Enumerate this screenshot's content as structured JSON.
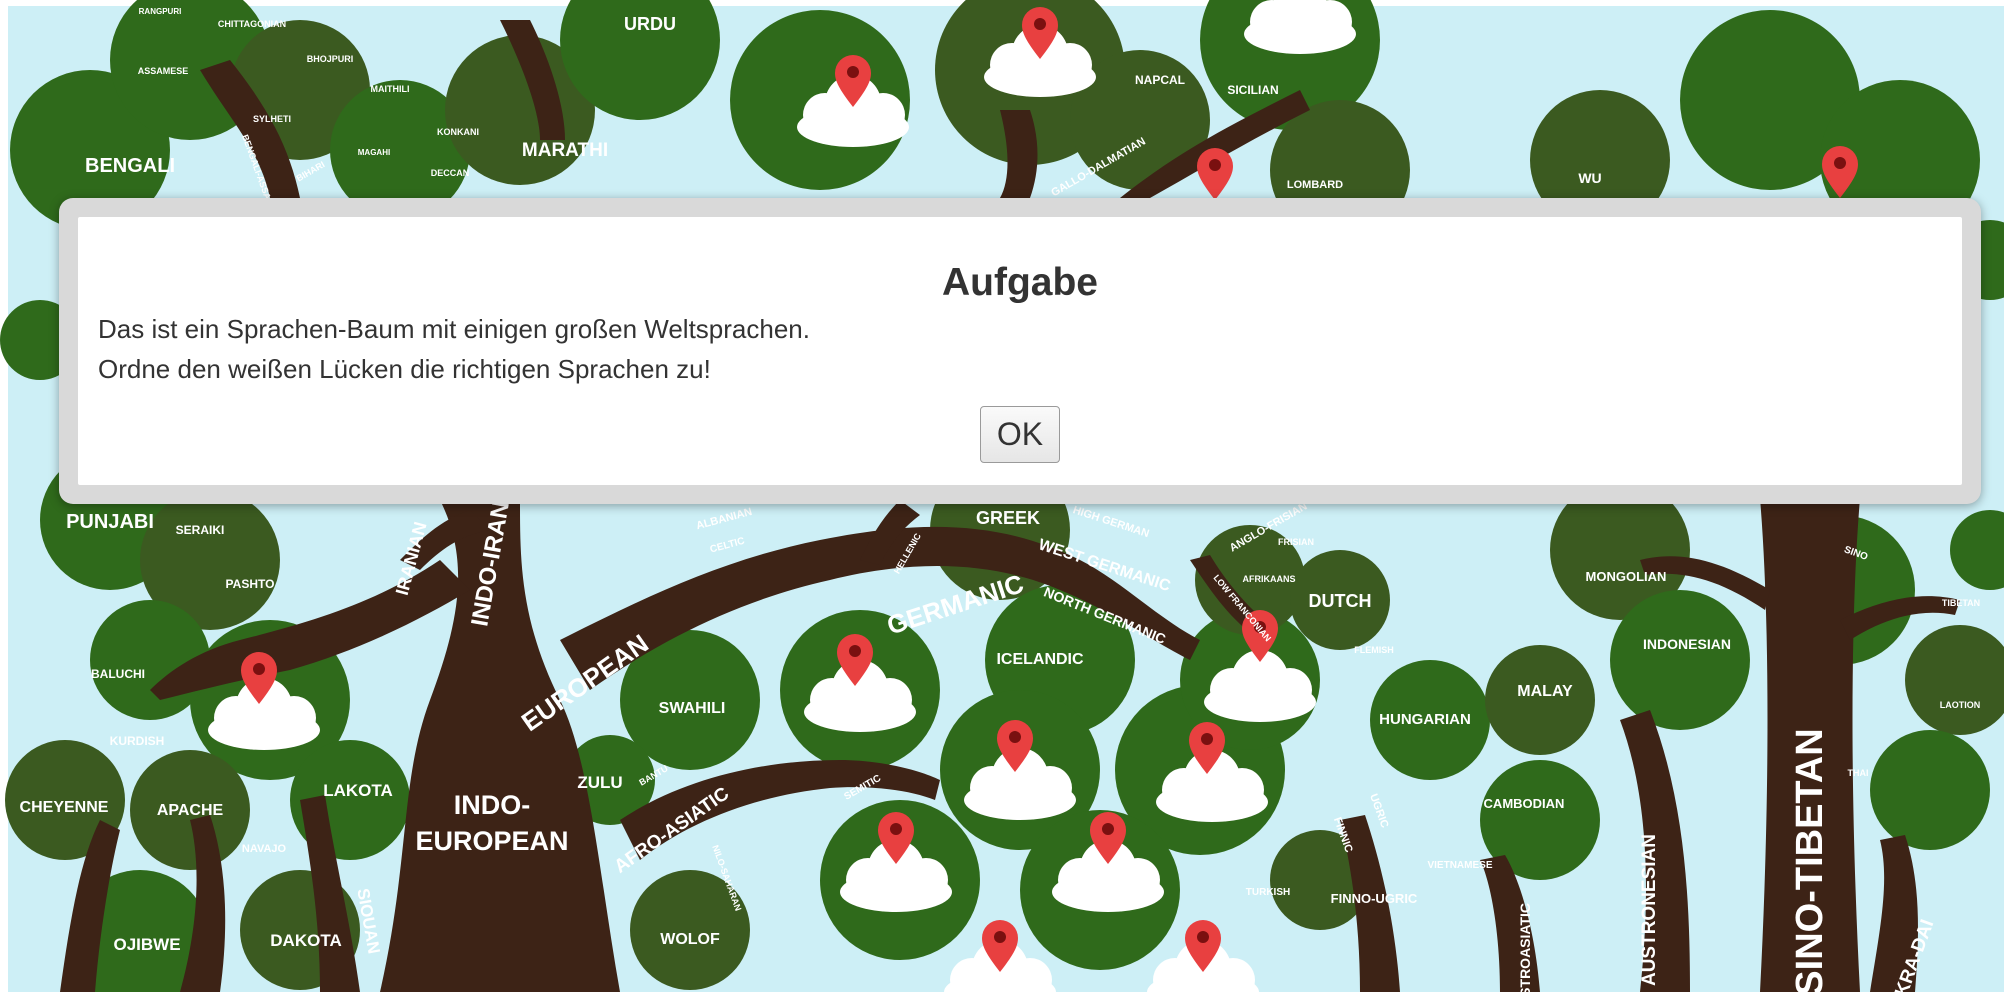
{
  "tree_labels": {
    "bengali": "BENGALI",
    "urdu": "URDU",
    "marathi": "MARATHI",
    "napcal": "NAPCAL",
    "sicilian": "SICILIAN",
    "lombard": "LOMBARD",
    "wu": "WU",
    "punjabi": "PUNJABI",
    "seraiki": "SERAIKI",
    "pashto": "PASHTO",
    "baluchi": "BALUCHI",
    "kurdish": "KURDISH",
    "iranian": "IRANIAN",
    "indo_iranian": "INDO-IRAN",
    "european": "EUROPEAN",
    "indo": "INDO-",
    "europeanb": "EUROPEAN",
    "germanic": "GERMANIC",
    "greek": "GREEK",
    "west_germanic": "WEST GERMANIC",
    "north_germanic": "NORTH GERMANIC",
    "icelandic": "ICELANDIC",
    "dutch": "DUTCH",
    "afrikaans": "AFRIKAANS",
    "flemish": "FLEMISH",
    "swahili": "SWAHILI",
    "zulu": "ZULU",
    "bantu": "BANTU",
    "afro_asiatic": "AFRO-ASIATIC",
    "semitic": "SEMITIC",
    "wolof": "WOLOF",
    "cheyenne": "CHEYENNE",
    "apache": "APACHE",
    "lakota": "LAKOTA",
    "navajo": "NAVAJO",
    "siouan": "SIOUAN",
    "ojibwe": "OJIBWE",
    "dakota": "DAKOTA",
    "hungarian": "HUNGARIAN",
    "finnic": "FINNIC",
    "ugric": "UGRIC",
    "finno_ugric": "FINNO-UGRIC",
    "turkish": "TURKISH",
    "vietnamese": "VIETNAMESE",
    "cambodian": "CAMBODIAN",
    "malay": "MALAY",
    "indonesian": "INDONESIAN",
    "mongolian": "MONGOLIAN",
    "tibetan": "TIBETAN",
    "sino_tibetan": "SINO-TIBETAN",
    "austronesian": "AUSTRONESIAN",
    "austroasiatic": "AUSTROASIATIC",
    "thai": "THAI",
    "lao": "LAOTION",
    "kra_dai": "KRA-DAI",
    "albanian": "ALBANIAN",
    "celtic": "CELTIC",
    "frisian": "FRISIAN",
    "anglo_frisian": "ANGLO-FRISIAN",
    "low_franconian": "LOW FRANCONIAN",
    "high_german": "HIGH GERMAN",
    "hellenic": "HELLENIC",
    "assamese": "ASSAMESE",
    "sylheti": "SYLHETI",
    "chittagonian": "CHITTAGONIAN",
    "bhojpuri": "BHOJPURI",
    "maithili": "MAITHILI",
    "magahi": "MAGAHI",
    "bihari": "BIHARI",
    "konkani": "KONKANI",
    "deccan": "DECCAN",
    "sino": "SINO",
    "gallo_dalmatian": "GALLO-DALMATIAN",
    "rangpuri": "RANGPURI",
    "bengali_assamese": "BENGALI-ASSAMESE",
    "oromo": "NILO-SAHARAN"
  },
  "dialog": {
    "title": "Aufgabe",
    "line1": "Das ist ein Sprachen-Baum mit einigen großen Weltsprachen.",
    "line2": "Ordne den weißen Lücken die richtigen Sprachen zu!",
    "ok_label": "OK"
  },
  "colors": {
    "sky": "#cdeff6",
    "trunk": "#3d2316",
    "leaf_dark": "#3b5a20",
    "leaf_mid": "#2f6a1b",
    "pin": "#e84040"
  }
}
